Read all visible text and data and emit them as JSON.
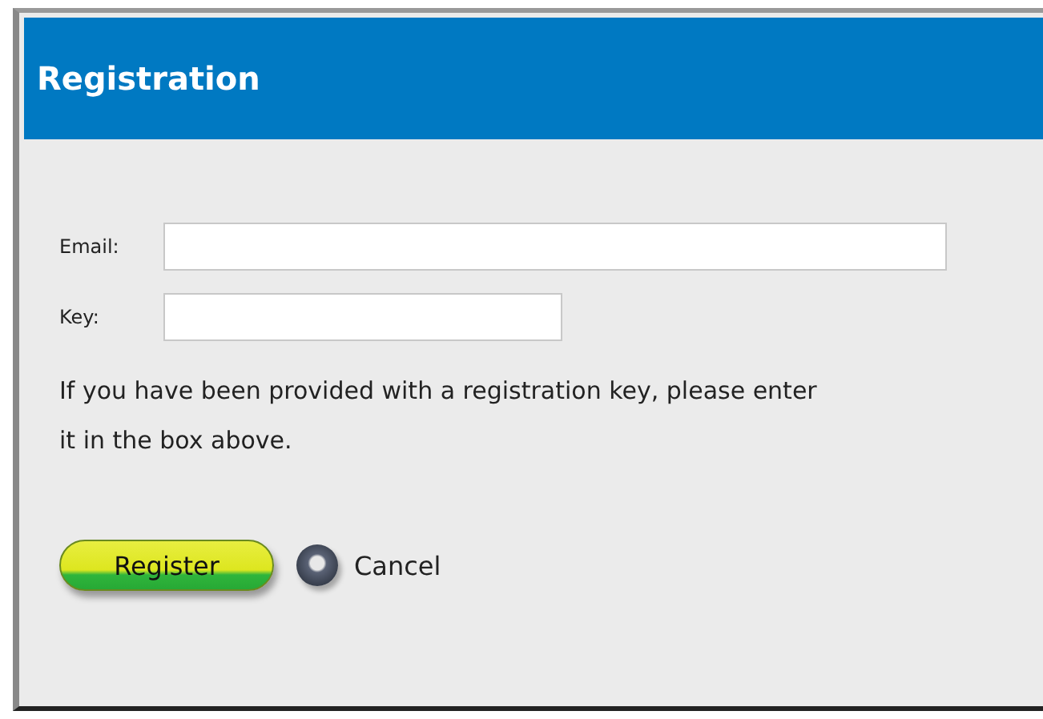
{
  "window": {
    "title": "Registration"
  },
  "fields": [
    {
      "label": "Email:"
    },
    {
      "label": "Key:"
    }
  ],
  "message": "If you have been provided with a registration key, please enter it in the box above.",
  "buttons": [
    {
      "label": "Register",
      "kind": "primary"
    },
    {
      "label": "Cancel",
      "kind": "orb"
    }
  ]
}
